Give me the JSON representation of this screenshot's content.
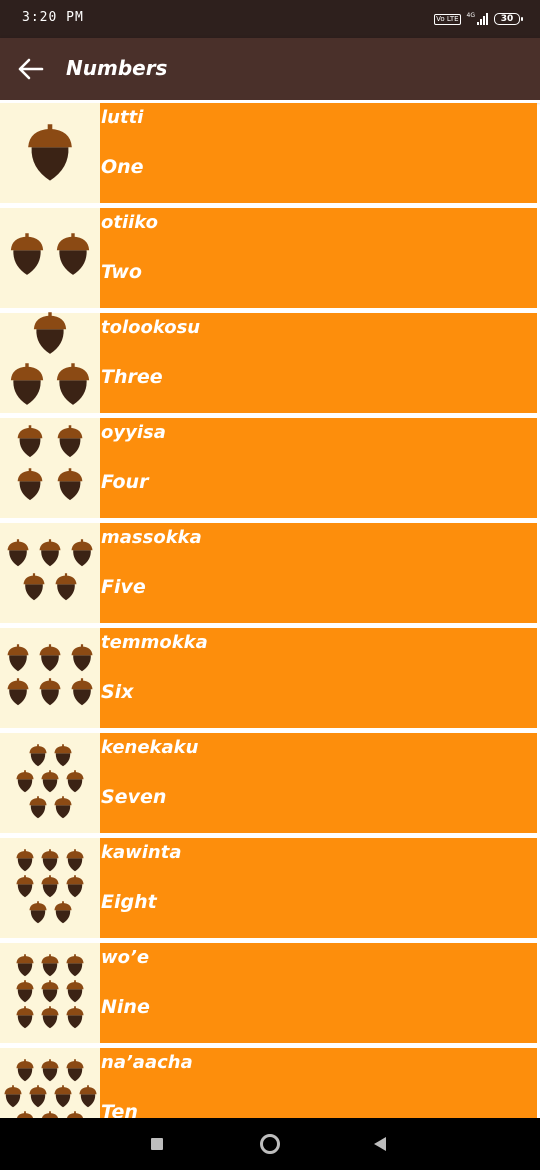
{
  "status_bar": {
    "time": "3:20 PM",
    "volte": "Vo LTE",
    "network": "4G",
    "battery": "30"
  },
  "app_bar": {
    "back_icon": "arrow-left-icon",
    "title": "Numbers"
  },
  "colors": {
    "status_bar": "#2e201d",
    "app_bar": "#4a302a",
    "image_bg": "#fdf6da",
    "text_bg": "#fd8e0c",
    "acorn_cap": "#8b4a14",
    "acorn_body": "#3b2315"
  },
  "numbers": [
    {
      "miwok": "lutti",
      "english": "One",
      "count": 1,
      "layout": [
        1
      ]
    },
    {
      "miwok": "otiiko",
      "english": "Two",
      "count": 2,
      "layout": [
        2
      ]
    },
    {
      "miwok": "tolookosu",
      "english": "Three",
      "count": 3,
      "layout": [
        1,
        2
      ]
    },
    {
      "miwok": "oyyisa",
      "english": "Four",
      "count": 4,
      "layout": [
        2,
        2
      ]
    },
    {
      "miwok": "massokka",
      "english": "Five",
      "count": 5,
      "layout": [
        3,
        2
      ]
    },
    {
      "miwok": "temmokka",
      "english": "Six",
      "count": 6,
      "layout": [
        3,
        3
      ]
    },
    {
      "miwok": "kenekaku",
      "english": "Seven",
      "count": 7,
      "layout": [
        2,
        3,
        2
      ]
    },
    {
      "miwok": "kawinta",
      "english": "Eight",
      "count": 8,
      "layout": [
        3,
        3,
        2
      ]
    },
    {
      "miwok": "wo’e",
      "english": "Nine",
      "count": 9,
      "layout": [
        3,
        3,
        3
      ]
    },
    {
      "miwok": "na’aacha",
      "english": "Ten",
      "count": 10,
      "layout": [
        3,
        4,
        3
      ]
    }
  ],
  "nav_bar": {
    "recents_icon": "square-recents-icon",
    "home_icon": "circle-home-icon",
    "back_icon": "triangle-back-icon"
  }
}
